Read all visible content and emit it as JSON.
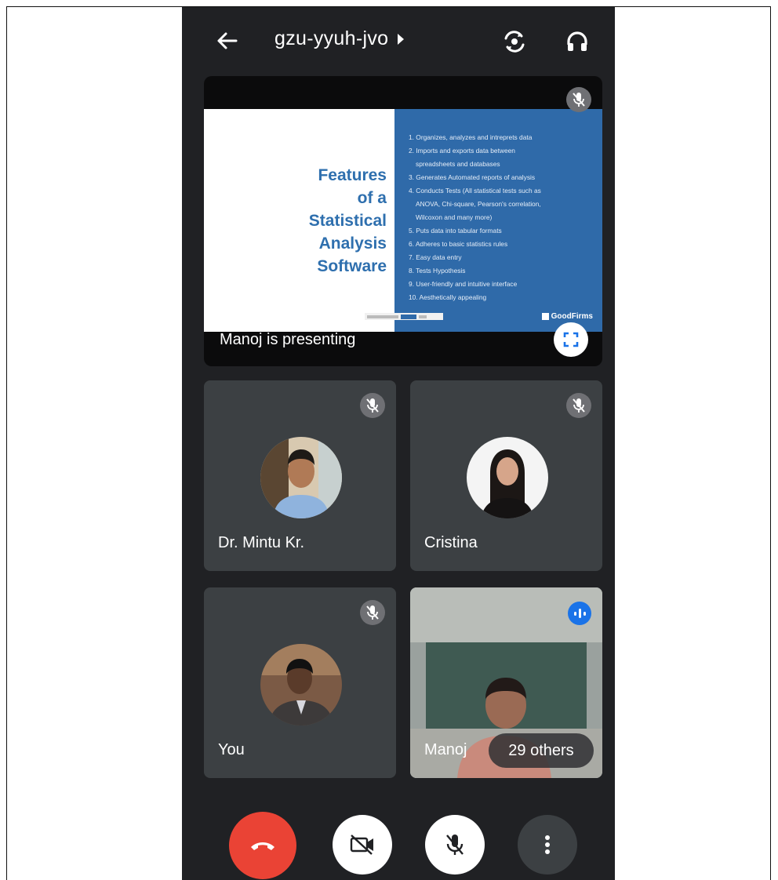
{
  "header": {
    "meeting_code": "gzu-yyuh-jvo"
  },
  "presentation": {
    "slide_title_lines": [
      "Features",
      "of a",
      "Statistical",
      "Analysis",
      "Software"
    ],
    "slide_items": [
      "1. Organizes, analyzes and intreprets data",
      "2. Imports and exports data between",
      "spreadsheets and databases",
      "3. Generates Automated reports of analysis",
      "4. Conducts Tests (All statistical tests such as",
      "ANOVA, Chi-square, Pearson's correlation,",
      "Wilcoxon and many more)",
      "5. Puts data into tabular formats",
      "6. Adheres to basic statistics rules",
      "7. Easy data entry",
      "8. Tests Hypothesis",
      "9. User-friendly and intuitive interface",
      "10. Aesthetically appealing"
    ],
    "slide_brand": "GoodFirms",
    "presenting_label": "Manoj is presenting"
  },
  "participants": [
    {
      "name": "Dr. Mintu Kr.",
      "muted": true
    },
    {
      "name": "Cristina",
      "muted": true
    },
    {
      "name": "You",
      "muted": true
    },
    {
      "name": "Manoj",
      "speaking": true
    }
  ],
  "others_label": "29 others",
  "colors": {
    "background": "#202124",
    "tile": "#3c4043",
    "end_call": "#ea4335",
    "speaking": "#1a73e8",
    "slide_blue": "#2f6aa9",
    "slide_title": "#2e6fae"
  },
  "icons": {
    "back": "arrow-left-icon",
    "switch_camera": "switch-camera-icon",
    "audio": "headphones-icon",
    "muted": "mic-off-icon",
    "fullscreen": "fullscreen-icon",
    "speaking": "audio-level-icon",
    "end_call": "phone-hangup-icon",
    "camera": "camera-off-icon",
    "mic": "mic-off-icon",
    "more": "more-vertical-icon"
  }
}
